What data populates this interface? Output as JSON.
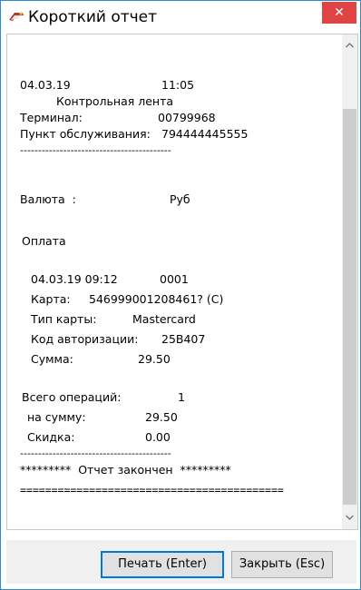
{
  "window": {
    "title": "Короткий отчет",
    "close_glyph": "✕",
    "accent": "#2a8dd4",
    "close_color": "#e04343"
  },
  "receipt": {
    "date": "04.03.19",
    "time": "11:05",
    "tape_title": "Контрольная лента",
    "terminal_label": "Терминал:",
    "terminal_value": "00799968",
    "point_label": "Пункт обслуживания:",
    "point_value": "794444445555",
    "separator_short": "------------------------------------------",
    "currency_label": "Валюта  :",
    "currency_value": "Руб",
    "payment_title": "Оплата",
    "op_datetime": "04.03.19 09:12",
    "op_number": "0001",
    "card_label": "Карта:",
    "card_value": "546999001208461? (C)",
    "card_type_label": "Тип карты:",
    "card_type_value": "Mastercard",
    "auth_label": "Код авторизации:",
    "auth_value": "25B407",
    "sum_label": "Сумма:",
    "sum_value": "29.50",
    "total_ops_label": "Всего операций:",
    "total_ops_value": "1",
    "total_sum_label": "на сумму:",
    "total_sum_value": "29.50",
    "discount_label": "Скидка:",
    "discount_value": "0.00",
    "separator_short2": "------------------------------------------",
    "report_end": "*********  Отчет закончен  *********",
    "separator_double": "=========================================="
  },
  "buttons": {
    "print_label": "Печать (Enter)",
    "close_label": "Закрыть (Esc)"
  },
  "scrollbar": {
    "up_glyph": "^",
    "down_glyph": "v"
  }
}
